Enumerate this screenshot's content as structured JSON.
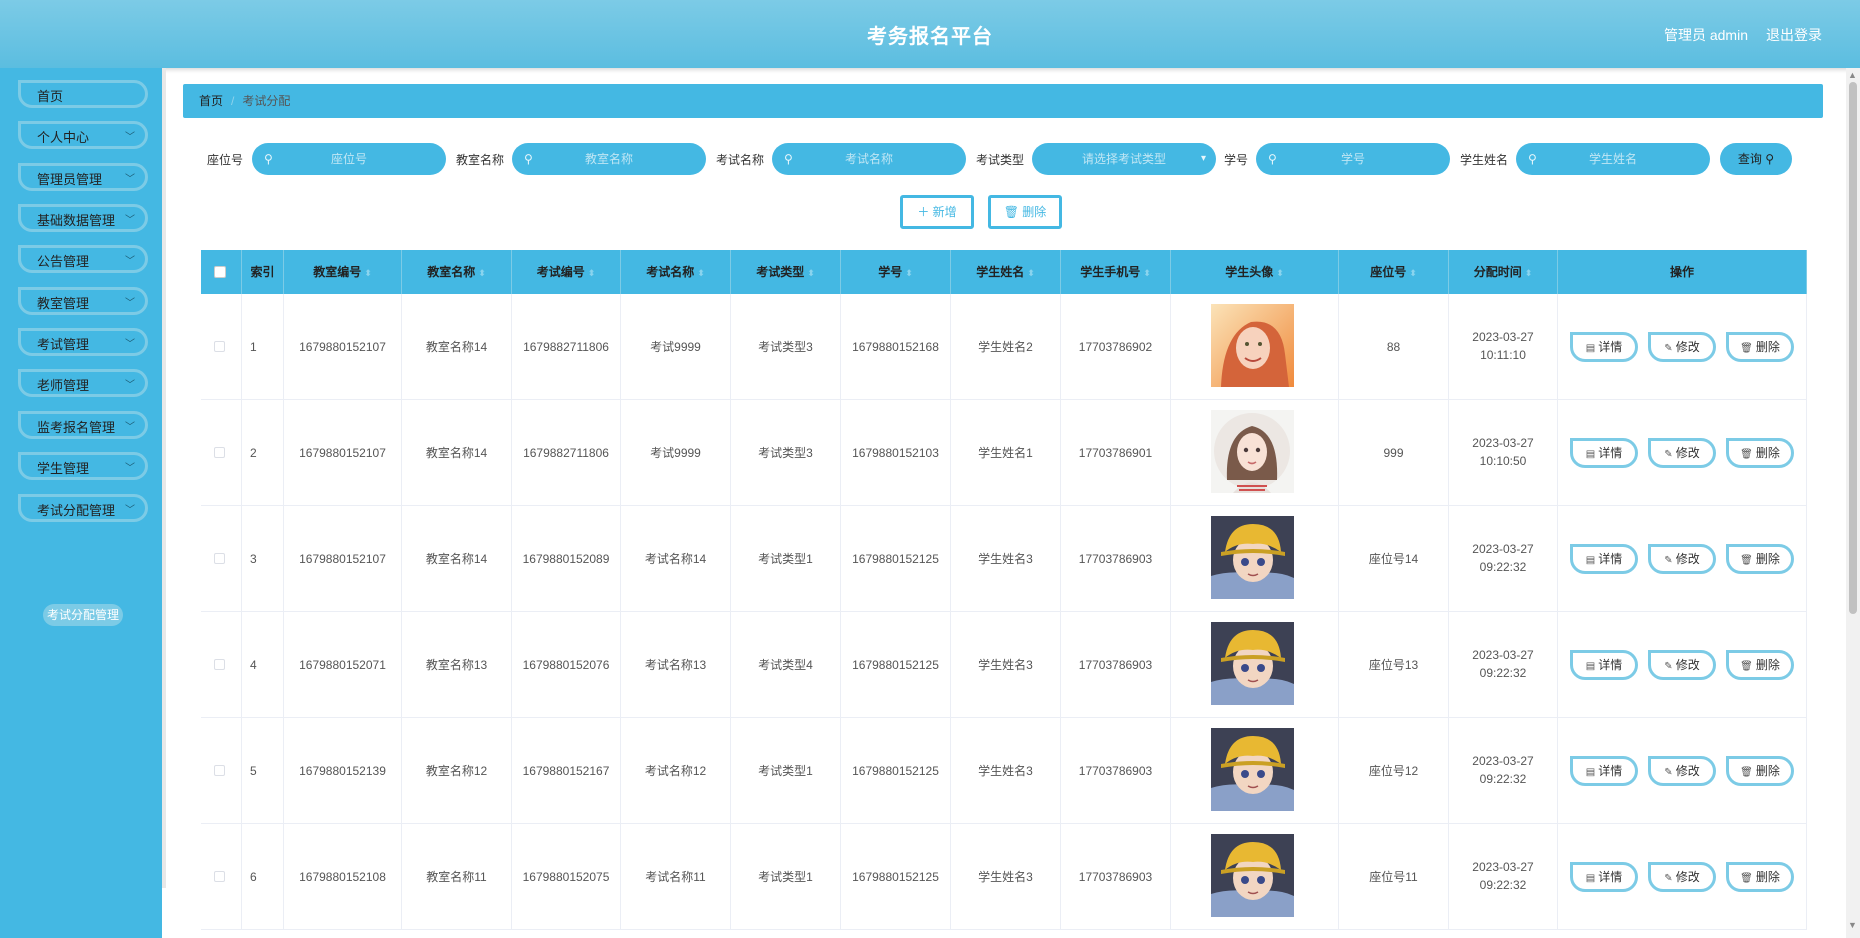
{
  "app": {
    "title": "考务报名平台",
    "user": "管理员 admin",
    "logout": "退出登录"
  },
  "sidebar": {
    "items": [
      {
        "label": "首页",
        "chevron": false
      },
      {
        "label": "个人中心",
        "chevron": true
      },
      {
        "label": "管理员管理",
        "chevron": true
      },
      {
        "label": "基础数据管理",
        "chevron": true
      },
      {
        "label": "公告管理",
        "chevron": true
      },
      {
        "label": "教室管理",
        "chevron": true
      },
      {
        "label": "考试管理",
        "chevron": true
      },
      {
        "label": "老师管理",
        "chevron": true
      },
      {
        "label": "监考报名管理",
        "chevron": true
      },
      {
        "label": "学生管理",
        "chevron": true
      },
      {
        "label": "考试分配管理",
        "chevron": true
      }
    ],
    "active_sub": "考试分配管理"
  },
  "breadcrumb": {
    "home": "首页",
    "current": "考试分配"
  },
  "search": {
    "fields": [
      {
        "label": "座位号",
        "placeholder": "座位号"
      },
      {
        "label": "教室名称",
        "placeholder": "教室名称"
      },
      {
        "label": "考试名称",
        "placeholder": "考试名称"
      },
      {
        "label": "考试类型",
        "placeholder": "请选择考试类型"
      },
      {
        "label": "学号",
        "placeholder": "学号"
      },
      {
        "label": "学生姓名",
        "placeholder": "学生姓名"
      }
    ],
    "query": "查询"
  },
  "actions": {
    "add": "＋ 新增",
    "delete": "删除"
  },
  "table": {
    "columns": [
      "索引",
      "教室编号",
      "教室名称",
      "考试编号",
      "考试名称",
      "考试类型",
      "学号",
      "学生姓名",
      "学生手机号",
      "学生头像",
      "座位号",
      "分配时间",
      "操作"
    ],
    "rows": [
      {
        "idx": "1",
        "room_no": "1679880152107",
        "room": "教室名称14",
        "exam_no": "1679882711806",
        "exam": "考试9999",
        "type": "考试类型3",
        "student_no": "1679880152168",
        "name": "学生姓名2",
        "phone": "17703786902",
        "avatar": "woman",
        "seat": "88",
        "time": "2023-03-27 10:11:10"
      },
      {
        "idx": "2",
        "room_no": "1679880152107",
        "room": "教室名称14",
        "exam_no": "1679882711806",
        "exam": "考试9999",
        "type": "考试类型3",
        "student_no": "1679880152103",
        "name": "学生姓名1",
        "phone": "17703786901",
        "avatar": "girl",
        "seat": "999",
        "time": "2023-03-27 10:10:50"
      },
      {
        "idx": "3",
        "room_no": "1679880152107",
        "room": "教室名称14",
        "exam_no": "1679880152089",
        "exam": "考试名称14",
        "type": "考试类型1",
        "student_no": "1679880152125",
        "name": "学生姓名3",
        "phone": "17703786903",
        "avatar": "boy",
        "seat": "座位号14",
        "time": "2023-03-27 09:22:32"
      },
      {
        "idx": "4",
        "room_no": "1679880152071",
        "room": "教室名称13",
        "exam_no": "1679880152076",
        "exam": "考试名称13",
        "type": "考试类型4",
        "student_no": "1679880152125",
        "name": "学生姓名3",
        "phone": "17703786903",
        "avatar": "boy",
        "seat": "座位号13",
        "time": "2023-03-27 09:22:32"
      },
      {
        "idx": "5",
        "room_no": "1679880152139",
        "room": "教室名称12",
        "exam_no": "1679880152167",
        "exam": "考试名称12",
        "type": "考试类型1",
        "student_no": "1679880152125",
        "name": "学生姓名3",
        "phone": "17703786903",
        "avatar": "boy",
        "seat": "座位号12",
        "time": "2023-03-27 09:22:32"
      },
      {
        "idx": "6",
        "room_no": "1679880152108",
        "room": "教室名称11",
        "exam_no": "1679880152075",
        "exam": "考试名称11",
        "type": "考试类型1",
        "student_no": "1679880152125",
        "name": "学生姓名3",
        "phone": "17703786903",
        "avatar": "boy",
        "seat": "座位号11",
        "time": "2023-03-27 09:22:32"
      }
    ],
    "ops": [
      "详情",
      "修改",
      "删除"
    ]
  },
  "colors": {
    "accent": "#44b8e3",
    "accent_light": "#7ccbe6"
  }
}
